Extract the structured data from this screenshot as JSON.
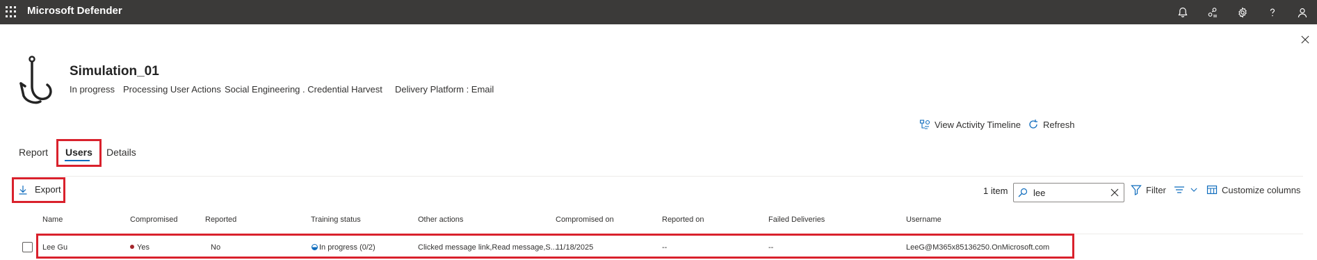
{
  "topbar": {
    "app_title": "Microsoft Defender",
    "icons": [
      "waffle-icon",
      "bell-icon",
      "people-connect-icon",
      "gear-icon",
      "help-icon",
      "user-icon"
    ]
  },
  "header": {
    "title": "Simulation_01",
    "status": "In progress",
    "processing": "Processing User Actions",
    "technique": "Social Engineering . Credential Harvest",
    "delivery": "Delivery Platform : Email"
  },
  "actions": {
    "timeline": "View Activity Timeline",
    "refresh": "Refresh"
  },
  "tabs": [
    {
      "label": "Report"
    },
    {
      "label": "Users",
      "active": true
    },
    {
      "label": "Details"
    }
  ],
  "toolbar": {
    "export": "Export",
    "count": "1 item",
    "search_value": "lee",
    "filter": "Filter",
    "customize": "Customize columns"
  },
  "table": {
    "columns": [
      "Name",
      "Compromised",
      "Reported",
      "Training status",
      "Other actions",
      "Compromised on",
      "Reported on",
      "Failed Deliveries",
      "Username"
    ],
    "rows": [
      {
        "name": "Lee Gu",
        "compromised": "Yes",
        "reported": "No",
        "training_status": "In progress (0/2)",
        "other_actions": "Clicked message link,Read message,S...",
        "compromised_on": "11/18/2025",
        "reported_on": "--",
        "failed_deliveries": "--",
        "username": "LeeG@M365x85136250.OnMicrosoft.com"
      }
    ]
  },
  "colors": {
    "topbar": "#3b3a39",
    "highlight": "#d9212c",
    "accent": "#0f6cbd",
    "compromised_dot": "#a4262c"
  }
}
